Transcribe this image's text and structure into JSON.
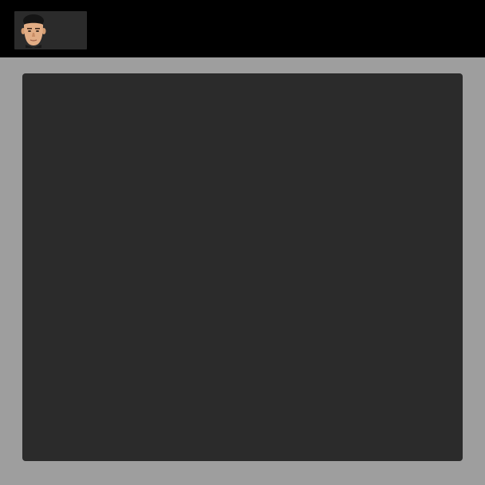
{
  "topbar": {
    "background": "#000000",
    "avatar": {
      "icon": "user-avatar-icon",
      "tile_color": "#2b2b2b"
    }
  },
  "main": {
    "background": "#9e9e9e",
    "panel_color": "#2b2b2b"
  }
}
